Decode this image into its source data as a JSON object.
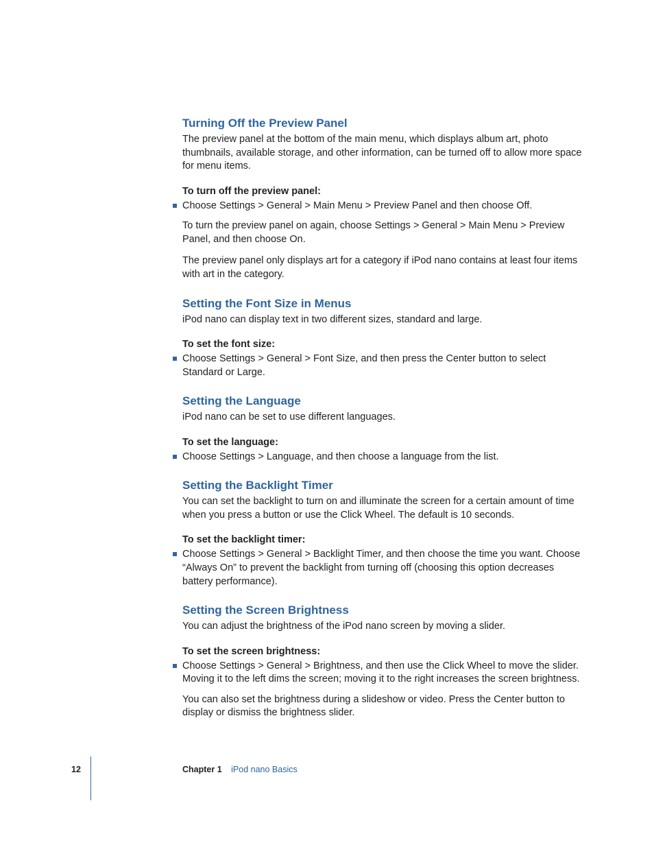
{
  "footer": {
    "page_number": "12",
    "chapter_label": "Chapter 1",
    "chapter_title": "iPod nano Basics"
  },
  "sections": {
    "s1": {
      "heading": "Turning Off the Preview Panel",
      "intro": "The preview panel at the bottom of the main menu, which displays album art, photo thumbnails, available storage, and other information, can be turned off to allow more space for menu items.",
      "sub": "To turn off the preview panel:",
      "bullet": "Choose Settings > General > Main Menu > Preview Panel and then choose Off.",
      "follow1": "To turn the preview panel on again, choose Settings > General > Main Menu > Preview Panel, and then choose On.",
      "follow2": "The preview panel only displays art for a category if iPod nano contains at least four items with art in the category."
    },
    "s2": {
      "heading": "Setting the Font Size in Menus",
      "intro": "iPod nano can display text in two different sizes, standard and large.",
      "sub": "To set the font size:",
      "bullet": "Choose Settings > General > Font Size, and then press the Center button to select Standard or Large."
    },
    "s3": {
      "heading": "Setting the Language",
      "intro": "iPod nano can be set to use different languages.",
      "sub": "To set the language:",
      "bullet": "Choose Settings > Language, and then choose a language from the list."
    },
    "s4": {
      "heading": "Setting the Backlight Timer",
      "intro": "You can set the backlight to turn on and illuminate the screen for a certain amount of time when you press a button or use the Click Wheel. The default is 10 seconds.",
      "sub": "To set the backlight timer:",
      "bullet": "Choose Settings > General > Backlight Timer, and then choose the time you want. Choose “Always On” to prevent the backlight from turning off (choosing this option decreases battery performance)."
    },
    "s5": {
      "heading": "Setting the Screen Brightness",
      "intro": "You can adjust the brightness of the iPod nano screen by moving a slider.",
      "sub": "To set the screen brightness:",
      "bullet": "Choose Settings > General > Brightness, and then use the Click Wheel to move the slider. Moving it to the left dims the screen; moving it to the right increases the screen brightness.",
      "follow1": "You can also set the brightness during a slideshow or video. Press the Center button to display or dismiss the brightness slider."
    }
  }
}
